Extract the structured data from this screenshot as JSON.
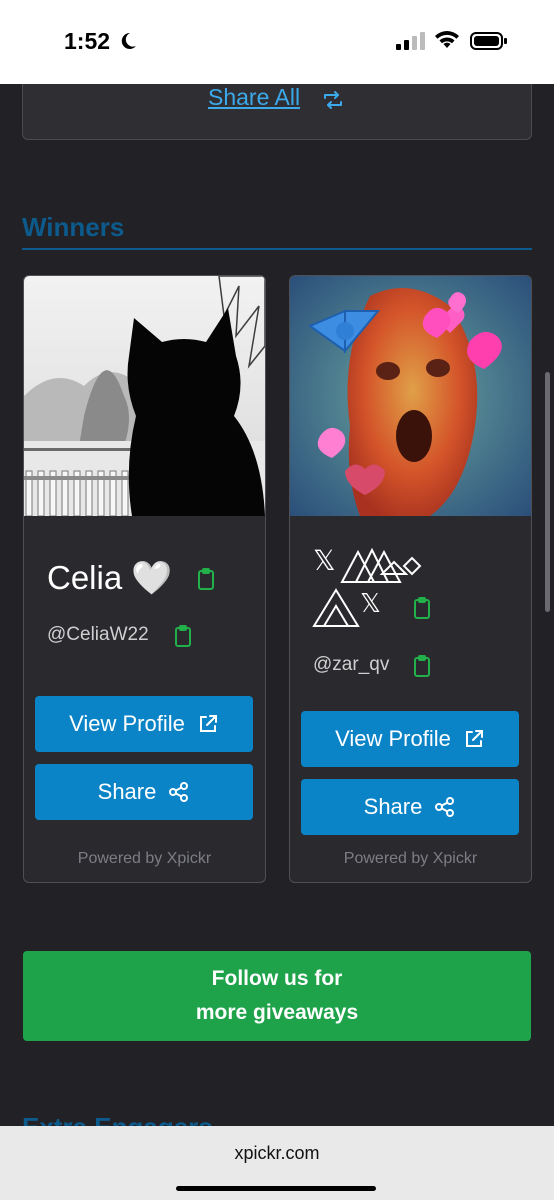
{
  "status_bar": {
    "time": "1:52"
  },
  "share_all": {
    "label": "Share All"
  },
  "winners": {
    "heading": "Winners",
    "cards": [
      {
        "name": "Celia 🤍",
        "handle": "@CeliaW22",
        "view_profile_label": "View Profile",
        "share_label": "Share",
        "powered_by": "Powered by Xpickr"
      },
      {
        "name": "𝕏",
        "handle": "@zar_qv",
        "view_profile_label": "View Profile",
        "share_label": "Share",
        "powered_by": "Powered by Xpickr"
      }
    ]
  },
  "follow": {
    "line1": "Follow us for",
    "line2": "more giveaways"
  },
  "extra": {
    "heading": "Extra Engagers"
  },
  "browser": {
    "url": "xpickr.com"
  },
  "colors": {
    "accent_blue": "#0b84c7",
    "link_blue": "#3ba9ea",
    "heading_blue": "#0d5a8c",
    "follow_green": "#1fa34a",
    "clipboard_green": "#22b04b"
  }
}
